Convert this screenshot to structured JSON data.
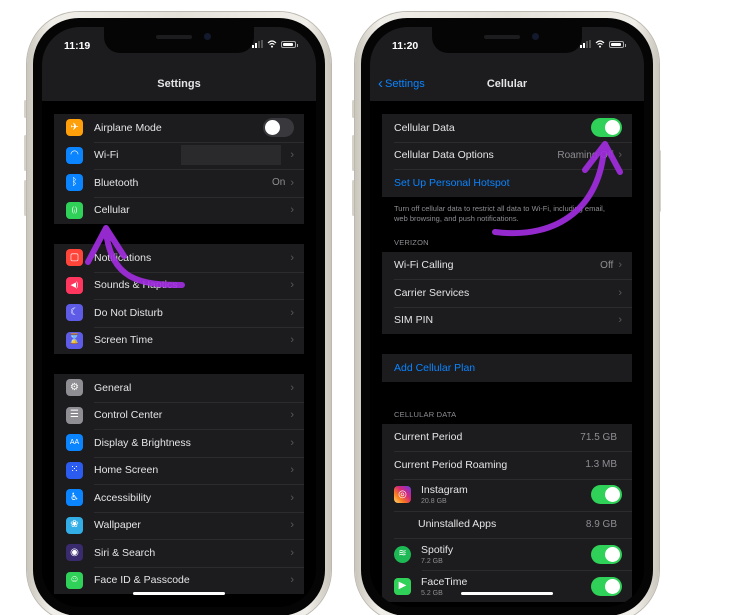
{
  "left_phone": {
    "status": {
      "time": "11:19"
    },
    "nav": {
      "title": "Settings"
    },
    "groups": [
      [
        {
          "label": "Airplane Mode",
          "icon": "airplane-icon",
          "icon_color": "#ff9f0a",
          "glyph": "✈",
          "control": "toggle",
          "toggle_on": false
        },
        {
          "label": "Wi-Fi",
          "icon": "wifi-icon",
          "icon_color": "#0a84ff",
          "glyph": "◠",
          "value": "",
          "value_masked": true
        },
        {
          "label": "Bluetooth",
          "icon": "bluetooth-icon",
          "icon_color": "#0a84ff",
          "glyph": "ᛒ",
          "value": "On"
        },
        {
          "label": "Cellular",
          "icon": "cellular-icon",
          "icon_color": "#30d158",
          "glyph": "(ᵢ)",
          "value": ""
        }
      ],
      [
        {
          "label": "Notifications",
          "icon": "notifications-icon",
          "icon_color": "#ff453a",
          "glyph": "▢",
          "value": ""
        },
        {
          "label": "Sounds & Haptics",
          "icon": "sounds-icon",
          "icon_color": "#ff375f",
          "glyph": "◀)",
          "value": ""
        },
        {
          "label": "Do Not Disturb",
          "icon": "moon-icon",
          "icon_color": "#5e5ce6",
          "glyph": "☾",
          "value": ""
        },
        {
          "label": "Screen Time",
          "icon": "hourglass-icon",
          "icon_color": "#5e5ce6",
          "glyph": "⌛",
          "value": ""
        }
      ],
      [
        {
          "label": "General",
          "icon": "gear-icon",
          "icon_color": "#8e8e93",
          "glyph": "⚙",
          "value": ""
        },
        {
          "label": "Control Center",
          "icon": "control-center-icon",
          "icon_color": "#8e8e93",
          "glyph": "☰",
          "value": ""
        },
        {
          "label": "Display & Brightness",
          "icon": "display-icon",
          "icon_color": "#0a84ff",
          "glyph": "AA",
          "value": ""
        },
        {
          "label": "Home Screen",
          "icon": "home-screen-icon",
          "icon_color": "#2c5bf0",
          "glyph": "⁙",
          "value": ""
        },
        {
          "label": "Accessibility",
          "icon": "accessibility-icon",
          "icon_color": "#0a84ff",
          "glyph": "♿",
          "value": ""
        },
        {
          "label": "Wallpaper",
          "icon": "wallpaper-icon",
          "icon_color": "#32ade6",
          "glyph": "❀",
          "value": ""
        },
        {
          "label": "Siri & Search",
          "icon": "siri-icon",
          "icon_color": "#3a2a6e",
          "glyph": "◉",
          "value": ""
        },
        {
          "label": "Face ID & Passcode",
          "icon": "face-id-icon",
          "icon_color": "#30d158",
          "glyph": "☺",
          "value": ""
        }
      ]
    ]
  },
  "right_phone": {
    "status": {
      "time": "11:20"
    },
    "nav": {
      "back_label": "Settings",
      "title": "Cellular"
    },
    "group1": {
      "cellular_data": {
        "label": "Cellular Data",
        "toggle_on": true
      },
      "cellular_data_options": {
        "label": "Cellular Data Options",
        "value": "Roaming Off"
      },
      "hotspot": {
        "label": "Set Up Personal Hotspot"
      }
    },
    "footer": "Turn off cellular data to restrict all data to Wi-Fi, including email, web browsing, and push notifications.",
    "carrier_header": "VERIZON",
    "carrier_rows": [
      {
        "label": "Wi-Fi Calling",
        "value": "Off"
      },
      {
        "label": "Carrier Services",
        "value": ""
      },
      {
        "label": "SIM PIN",
        "value": ""
      }
    ],
    "add_plan": "Add Cellular Plan",
    "usage_header": "CELLULAR DATA",
    "usage_rows": [
      {
        "label": "Current Period",
        "value": "71.5 GB"
      },
      {
        "label": "Current Period Roaming",
        "value": "1.3 MB"
      }
    ],
    "apps": [
      {
        "name": "Instagram",
        "size": "20.8 GB",
        "icon": "instagram-icon",
        "toggle_on": true
      },
      {
        "name": "Uninstalled Apps",
        "size": "",
        "value": "8.9 GB"
      },
      {
        "name": "Spotify",
        "size": "7.2 GB",
        "icon": "spotify-icon",
        "toggle_on": true
      },
      {
        "name": "FaceTime",
        "size": "5.2 GB",
        "icon": "facetime-icon",
        "toggle_on": true
      }
    ]
  },
  "colors": {
    "accent_blue": "#0a84ff",
    "toggle_green": "#30d158",
    "annotation_purple": "#a12ce0"
  }
}
